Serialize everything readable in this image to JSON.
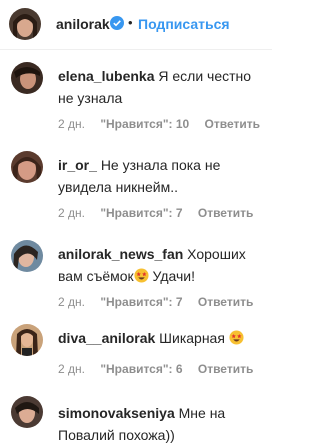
{
  "header": {
    "username": "anilorak",
    "separator": "•",
    "follow_label": "Подписаться"
  },
  "comments": [
    {
      "username": "elena_lubenka",
      "text": "Я если честно не узнала",
      "time": "2 дн.",
      "likes": "\"Нравится\": 10",
      "reply": "Ответить"
    },
    {
      "username": "ir_or_",
      "text": "Не узнала пока не увидела никнейм..",
      "time": "2 дн.",
      "likes": "\"Нравится\": 7",
      "reply": "Ответить"
    },
    {
      "username": "anilorak_news_fan",
      "text_before": "Хороших вам съёмок",
      "text_after": " Удачи!",
      "time": "2 дн.",
      "likes": "\"Нравится\": 7",
      "reply": "Ответить"
    },
    {
      "username": "diva__anilorak",
      "text": "Шикарная",
      "time": "2 дн.",
      "likes": "\"Нравится\": 6",
      "reply": "Ответить"
    },
    {
      "username": "simonovakseniya",
      "text": "Мне на Повалий похожа))"
    }
  ],
  "colors": {
    "link_blue": "#3897f0",
    "meta_gray": "#8e8e8e",
    "text": "#262626"
  }
}
